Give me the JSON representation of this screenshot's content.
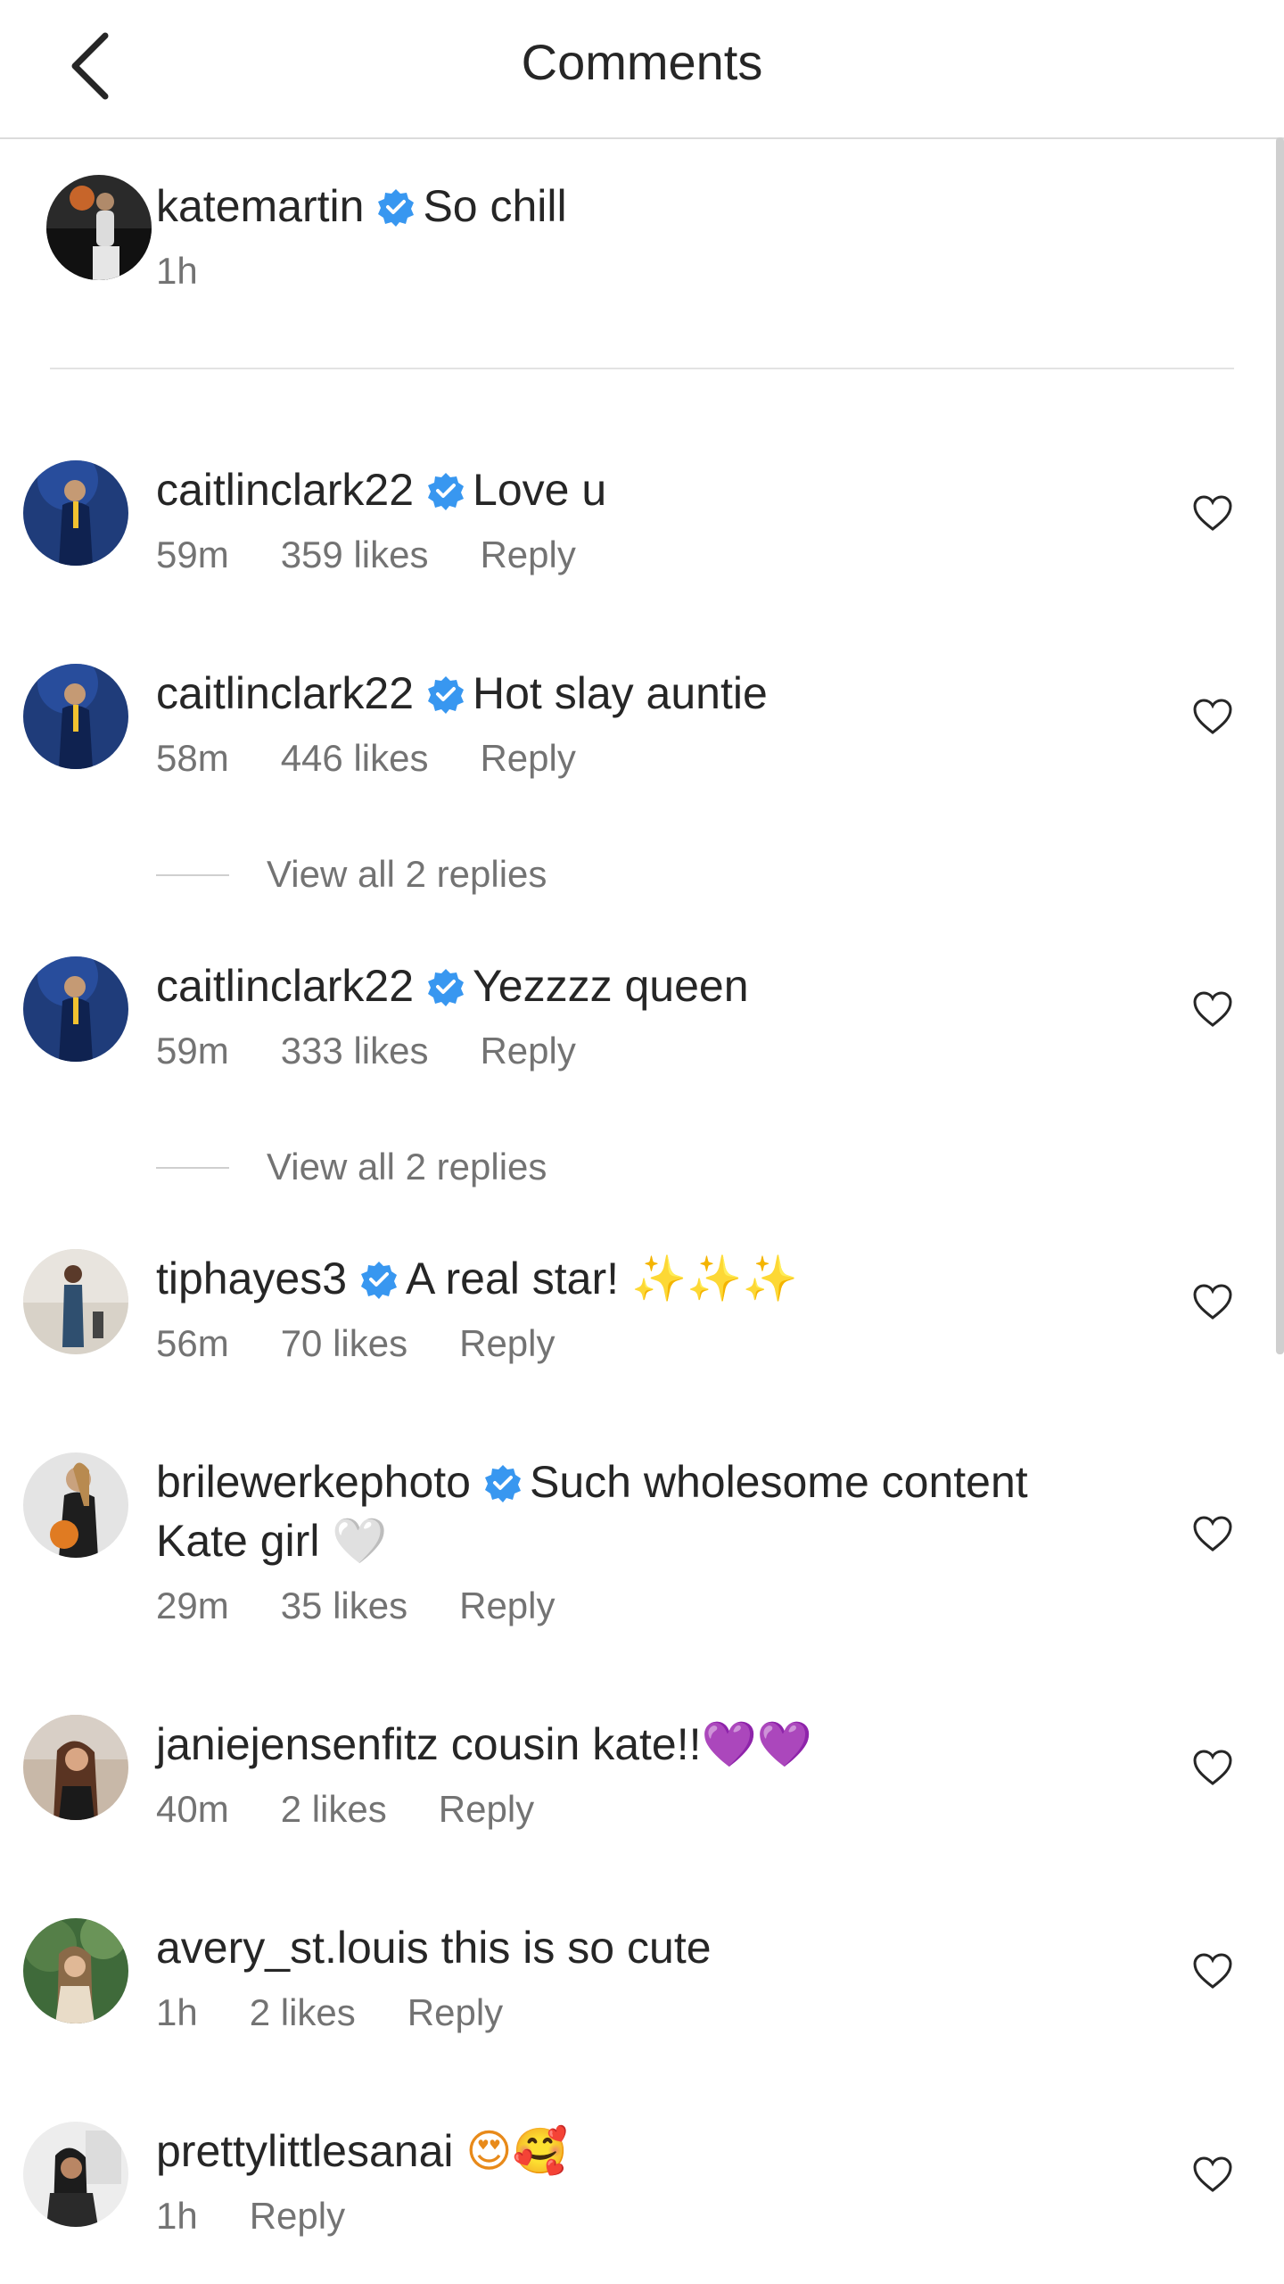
{
  "header": {
    "title": "Comments"
  },
  "caption": {
    "username": "katemartin",
    "verified": true,
    "text": "So chill",
    "time": "1h"
  },
  "comments": [
    {
      "username": "caitlinclark22",
      "verified": true,
      "text": "Love u",
      "time": "59m",
      "likes": "359 likes",
      "reply": "Reply"
    },
    {
      "username": "caitlinclark22",
      "verified": true,
      "text": "Hot slay auntie",
      "time": "58m",
      "likes": "446 likes",
      "reply": "Reply",
      "view_replies": "View all 2 replies"
    },
    {
      "username": "caitlinclark22",
      "verified": true,
      "text": "Yezzzz queen",
      "time": "59m",
      "likes": "333 likes",
      "reply": "Reply",
      "view_replies": "View all 2 replies"
    },
    {
      "username": "tiphayes3",
      "verified": true,
      "text": "A real star! ",
      "emoji": "✨✨✨",
      "time": "56m",
      "likes": "70 likes",
      "reply": "Reply"
    },
    {
      "username": "brilewerkephoto",
      "verified": true,
      "text": "Such wholesome content",
      "text2": "Kate girl ",
      "emoji": "🤍",
      "time": "29m",
      "likes": "35 likes",
      "reply": "Reply"
    },
    {
      "username": "janiejensenfitz",
      "verified": false,
      "text": "cousin kate!!",
      "emoji": "💜💜",
      "time": "40m",
      "likes": "2 likes",
      "reply": "Reply"
    },
    {
      "username": "avery_st.louis",
      "verified": false,
      "text": "this is so cute",
      "time": "1h",
      "likes": "2 likes",
      "reply": "Reply"
    },
    {
      "username": "prettylittlesanai",
      "verified": false,
      "text": "",
      "emoji": "😍🥰",
      "time": "1h",
      "reply": "Reply"
    }
  ],
  "colors": {
    "verified_badge": "#3897f0",
    "meta_text": "#737373",
    "primary_text": "#262626"
  },
  "icons": {
    "back": "chevron-left-icon",
    "like": "heart-outline-icon",
    "verified": "verified-badge-icon"
  }
}
